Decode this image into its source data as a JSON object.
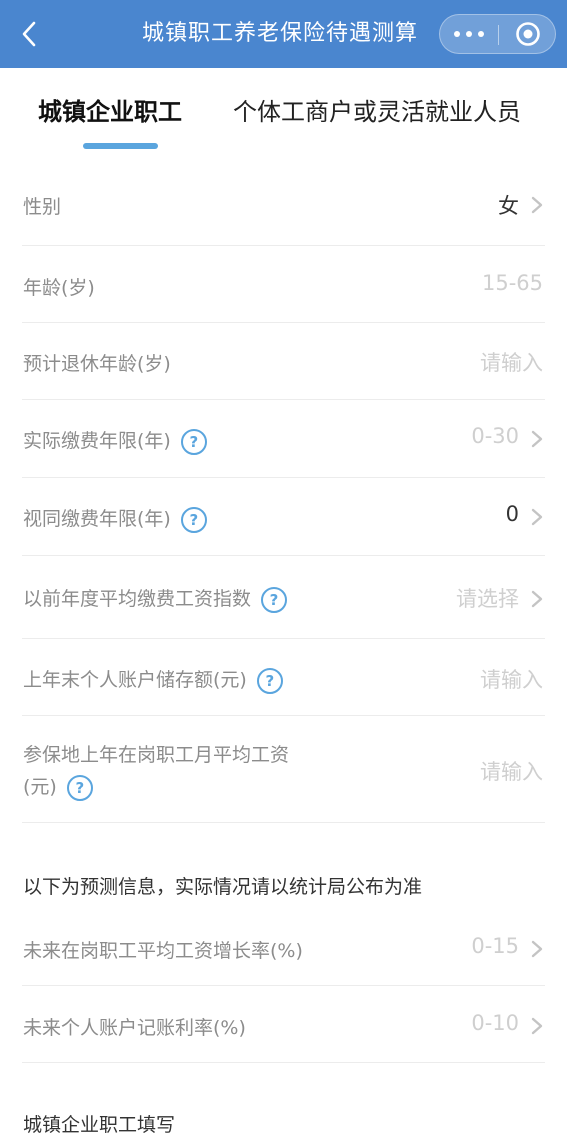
{
  "header": {
    "title": "城镇职工养老保险待遇测算",
    "back_icon": "chevron-left-icon",
    "more_icon": "more-dots-icon",
    "close_icon": "target-circle-icon",
    "bg_color": "#4a86cf"
  },
  "tabs": [
    {
      "label": "城镇企业职工",
      "active": true
    },
    {
      "label": "个体工商户或灵活就业人员",
      "active": false
    }
  ],
  "accent_color": "#5aa5de",
  "form": {
    "gender": {
      "label": "性别",
      "value": "女"
    },
    "age": {
      "label": "年龄(岁)",
      "placeholder": "15-65"
    },
    "retire_age": {
      "label": "预计退休年龄(岁)",
      "placeholder": "请输入"
    },
    "actual_years": {
      "label": "实际缴费年限(年)",
      "placeholder": "0-30"
    },
    "deemed_years": {
      "label": "视同缴费年限(年)",
      "value": "0"
    },
    "wage_index": {
      "label": "以前年度平均缴费工资指数",
      "placeholder": "请选择"
    },
    "account_balance": {
      "label": "上年末个人账户储存额(元)",
      "placeholder": "请输入"
    },
    "local_wage": {
      "label_line1": "参保地上年在岗职工月平均工资",
      "label_line2": "(元)",
      "placeholder": "请输入"
    }
  },
  "forecast": {
    "notice": "以下为预测信息，实际情况请以统计局公布为准",
    "wage_growth": {
      "label": "未来在岗职工平均工资增长率(%)",
      "placeholder": "0-15"
    },
    "interest_rate": {
      "label": "未来个人账户记账利率(%)",
      "placeholder": "0-10"
    }
  },
  "footer_section": "城镇企业职工填写",
  "help_glyph": "?"
}
